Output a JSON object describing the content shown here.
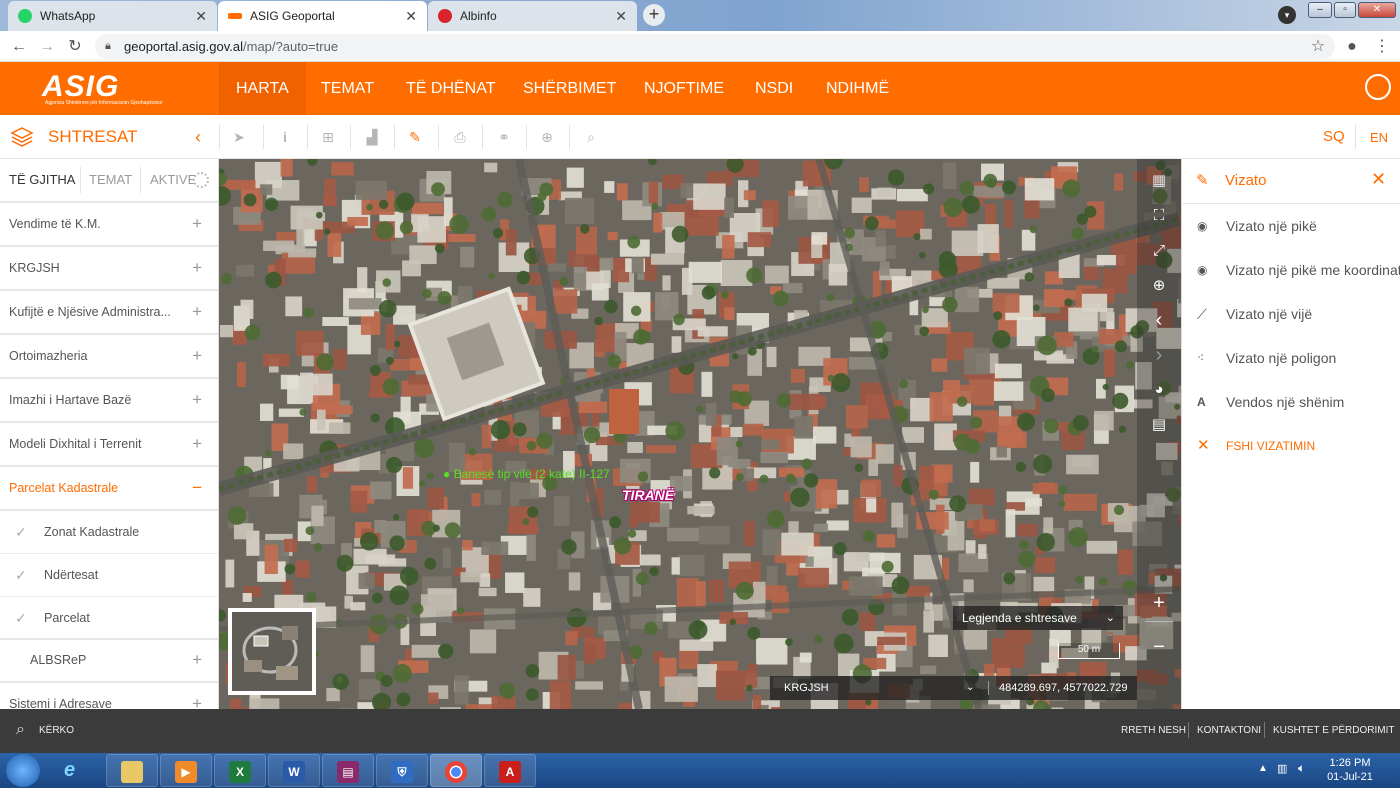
{
  "browser": {
    "tabs": [
      {
        "title": "WhatsApp",
        "color": "#25d366"
      },
      {
        "title": "ASIG Geoportal",
        "color": "#ff6c00"
      },
      {
        "title": "Albinfo",
        "color": "#d9232d"
      }
    ],
    "url_host": "geoportal.asig.gov.al",
    "url_path": "/map/?auto=true"
  },
  "header": {
    "logo": "ASIG",
    "logo_subtitle": "Agjencia Shtetërore për Informacionin Gjeohapësinor",
    "nav": [
      "HARTA",
      "TEMAT",
      "TË DHËNAT",
      "SHËRBIMET",
      "NJOFTIME",
      "NSDI",
      "NDIHMË"
    ],
    "active_nav": "HARTA"
  },
  "toolbar": {
    "title": "SHTRESAT",
    "collapse_icon": "chevron-left-icon",
    "tools": [
      "pointer-icon",
      "info-icon",
      "plus-box-icon",
      "chart-icon",
      "edit-icon",
      "print-icon",
      "link-icon",
      "add-circle-icon",
      "search-icon"
    ],
    "lang_sq": "SQ",
    "lang_en": "EN"
  },
  "left_panel": {
    "tabs": [
      "TË GJITHA",
      "TEMAT",
      "AKTIVE"
    ],
    "layers": [
      {
        "label": "Vendime të K.M.",
        "sign": "+"
      },
      {
        "label": "KRGJSH",
        "sign": "+"
      },
      {
        "label": "Kufijtë e Njësive Administra...",
        "sign": "+"
      },
      {
        "label": "Ortoimazheria",
        "sign": "+"
      },
      {
        "label": "Imazhi i Hartave Bazë",
        "sign": "+"
      },
      {
        "label": "Modeli Dixhital i Terrenit",
        "sign": "+"
      },
      {
        "label": "Parcelat Kadastrale",
        "sign": "−"
      }
    ],
    "sublayers": [
      "Zonat Kadastrale",
      "Ndërtesat",
      "Parcelat"
    ],
    "more_layers": [
      {
        "label": "ALBSReP",
        "sign": "+"
      },
      {
        "label": "Sistemi i Adresave",
        "sign": "+"
      }
    ]
  },
  "map": {
    "feature_label": "Banesë tip vilë (2 kate)   II-127",
    "city_label": "TIRANË",
    "legend_label": "Legjenda e shtresave",
    "scale": "50 m",
    "crs": "KRGJSH",
    "coordinates": "484289.697, 4577022.729",
    "zoom_in": "+",
    "zoom_out": "−"
  },
  "right_panel": {
    "title": "Vizato",
    "items": [
      {
        "label": "Vizato një pikë",
        "icon": "point-icon"
      },
      {
        "label": "Vizato një pikë me koordinata",
        "icon": "point-coordinate-icon"
      },
      {
        "label": "Vizato një vijë",
        "icon": "line-icon"
      },
      {
        "label": "Vizato një poligon",
        "icon": "polygon-icon"
      },
      {
        "label": "Vendos një shënim",
        "icon": "annotation-icon"
      }
    ],
    "clear_label": "FSHI VIZATIMIN"
  },
  "footer": {
    "search_label": "KËRKO",
    "links": [
      "RRETH NESH",
      "KONTAKTONI",
      "KUSHTET E PËRDORIMIT"
    ]
  },
  "taskbar": {
    "time": "1:26 PM",
    "date": "01-Jul-21"
  }
}
